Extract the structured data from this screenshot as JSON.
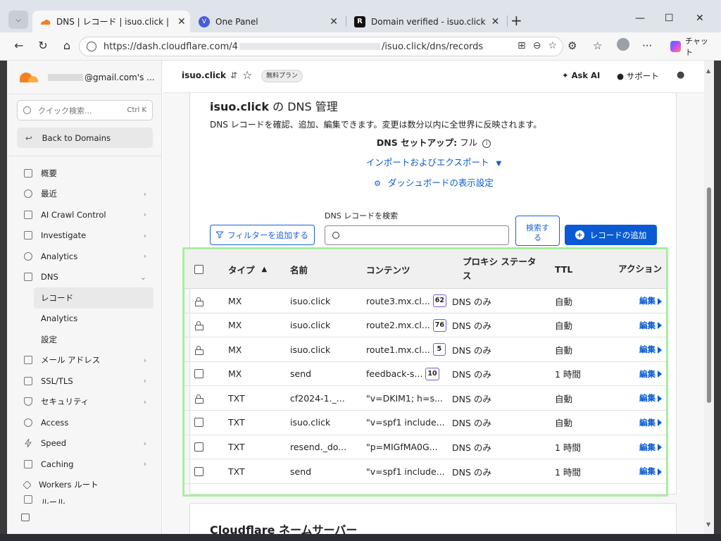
{
  "browser": {
    "tabs": [
      {
        "title": "DNS | レコード | isuo.click |",
        "active": true
      },
      {
        "title": "One Panel",
        "active": false
      },
      {
        "title": "Domain verified - isuo.click",
        "active": false
      }
    ],
    "url_prefix": "https://dash.cloudflare.com/4",
    "url_suffix": "/isuo.click/dns/records",
    "copilot_label": "チャット"
  },
  "sidebar": {
    "account": "@gmail.com's ...",
    "search_placeholder": "クイック検索...",
    "search_shortcut": "Ctrl K",
    "back_label": "Back to Domains",
    "items": [
      {
        "label": "概要",
        "chevron": false
      },
      {
        "label": "最近",
        "chevron": true
      },
      {
        "label": "AI Crawl Control",
        "chevron": true
      },
      {
        "label": "Investigate",
        "chevron": true
      },
      {
        "label": "Analytics",
        "chevron": true
      },
      {
        "label": "DNS",
        "chevron": true
      }
    ],
    "dns_sub": [
      {
        "label": "レコード",
        "active": true
      },
      {
        "label": "Analytics",
        "active": false
      },
      {
        "label": "設定",
        "active": false
      }
    ],
    "items2": [
      {
        "label": "メール アドレス",
        "chevron": true
      },
      {
        "label": "SSL/TLS",
        "chevron": true
      },
      {
        "label": "セキュリティ",
        "chevron": true
      },
      {
        "label": "Access",
        "chevron": false
      },
      {
        "label": "Speed",
        "chevron": true
      },
      {
        "label": "Caching",
        "chevron": true
      },
      {
        "label": "Workers ルート",
        "chevron": false
      },
      {
        "label": "ルール",
        "chevron": false
      }
    ]
  },
  "topbar": {
    "zone": "isuo.click",
    "plan_badge": "無料プラン",
    "ask_ai": "Ask AI",
    "support": "サポート"
  },
  "dns": {
    "title_domain": "isuo.click",
    "title_rest": " の DNS 管理",
    "description": "DNS レコードを確認、追加、編集できます。変更は数分以内に全世界に反映されます。",
    "setup_label": "DNS セットアップ:",
    "setup_value": " フル",
    "import_export": "インポートおよびエクスポート",
    "dashboard_settings": "ダッシュボードの表示設定",
    "search_label": "DNS レコードを検索",
    "filter_button": "フィルターを追加する",
    "search_button": "検索する",
    "add_button": "レコードの追加"
  },
  "table": {
    "headers": {
      "type": "タイプ",
      "name": "名前",
      "content": "コンテンツ",
      "proxy": "プロキシ ステータス",
      "ttl": "TTL",
      "actions": "アクション"
    },
    "rows": [
      {
        "locked": true,
        "type": "MX",
        "name": "isuo.click",
        "content": "route3.mx.cl...",
        "priority": "62",
        "proxy": "DNS のみ",
        "ttl": "自動",
        "edit": "編集"
      },
      {
        "locked": true,
        "type": "MX",
        "name": "isuo.click",
        "content": "route2.mx.cl...",
        "priority": "76",
        "proxy": "DNS のみ",
        "ttl": "自動",
        "edit": "編集"
      },
      {
        "locked": true,
        "type": "MX",
        "name": "isuo.click",
        "content": "route1.mx.cl...",
        "priority": "5",
        "proxy": "DNS のみ",
        "ttl": "自動",
        "edit": "編集"
      },
      {
        "locked": false,
        "type": "MX",
        "name": "send",
        "content": "feedback-s...",
        "priority": "10",
        "proxy": "DNS のみ",
        "ttl": "1 時間",
        "edit": "編集"
      },
      {
        "locked": true,
        "type": "TXT",
        "name": "cf2024-1._...",
        "content": "\"v=DKIM1; h=s...",
        "priority": "",
        "proxy": "DNS のみ",
        "ttl": "自動",
        "edit": "編集"
      },
      {
        "locked": false,
        "type": "TXT",
        "name": "isuo.click",
        "content": "\"v=spf1 include...",
        "priority": "",
        "proxy": "DNS のみ",
        "ttl": "自動",
        "edit": "編集"
      },
      {
        "locked": false,
        "type": "TXT",
        "name": "resend._do...",
        "content": "\"p=MIGfMA0G...",
        "priority": "",
        "proxy": "DNS のみ",
        "ttl": "1 時間",
        "edit": "編集"
      },
      {
        "locked": false,
        "type": "TXT",
        "name": "send",
        "content": "\"v=spf1 include...",
        "priority": "",
        "proxy": "DNS のみ",
        "ttl": "1 時間",
        "edit": "編集"
      }
    ]
  },
  "nameservers_title": "Cloudflare ネームサーバー",
  "colors": {
    "accent": "#0a5bd3",
    "highlight": "#a8ef9e",
    "cf_orange": "#f48120"
  }
}
